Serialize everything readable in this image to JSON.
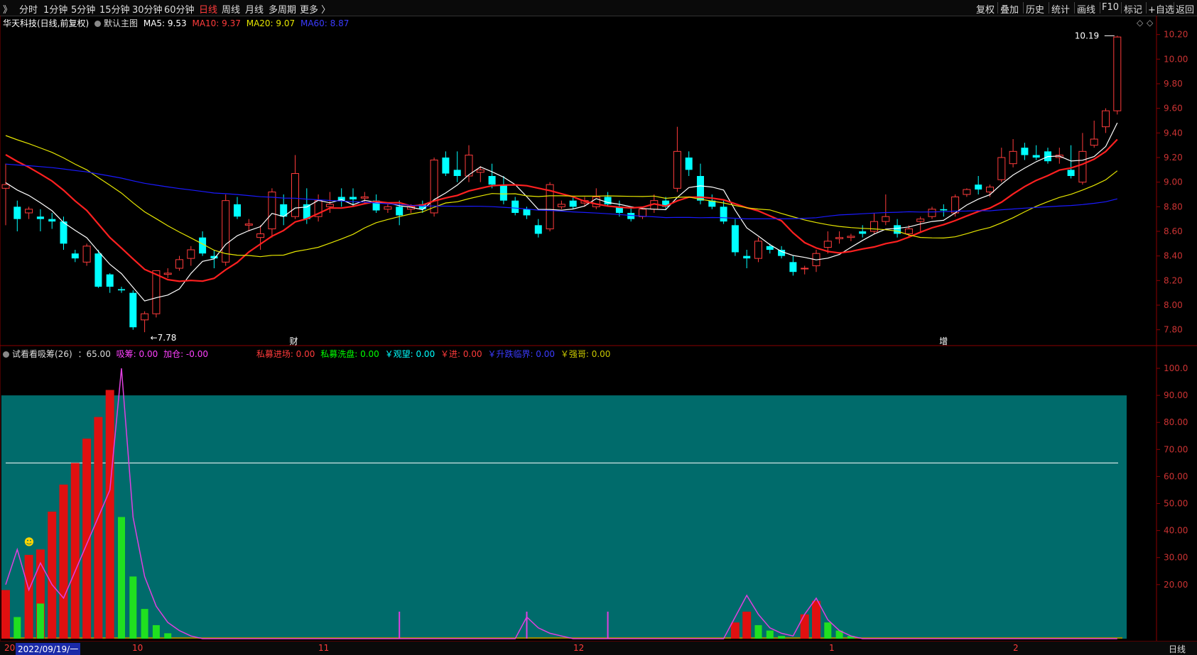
{
  "toolbar": {
    "back": "》",
    "periods": [
      "分时",
      "1分钟",
      "5分钟",
      "15分钟",
      "30分钟",
      "60分钟",
      "日线",
      "周线",
      "月线",
      "多周期",
      "更多 〉"
    ],
    "active_period": "日线",
    "right_items": [
      "复权",
      "叠加",
      "历史",
      "统计",
      "画线",
      "F10",
      "标记",
      "+自选",
      "返回"
    ]
  },
  "main_chart": {
    "title": "华天科技(日线,前复权)",
    "template": "默认主图",
    "ma5": "MA5: 9.53",
    "ma10": "MA10: 9.37",
    "ma20": "MA20: 9.07",
    "ma60": "MA60: 8.87",
    "high_label": "10.19",
    "low_label": "7.78",
    "event_cai": "财",
    "event_zeng": "增",
    "diamond": "◇",
    "y_ticks": [
      "10.20",
      "10.00",
      "9.80",
      "9.60",
      "9.40",
      "9.20",
      "9.00",
      "8.80",
      "8.60",
      "8.40",
      "8.20",
      "8.00",
      "7.80"
    ],
    "colors": {
      "up": "#ff3b3b",
      "down": "#00ffff",
      "ma5": "#ffffff",
      "ma10": "#ff2020",
      "ma20": "#e6e600",
      "ma60": "#1a1aff"
    }
  },
  "sub_chart": {
    "title": "试看看吸筹(26)",
    "value": "：65.00",
    "items": [
      {
        "label": "吸筹: 0.00",
        "color": "#ff40ff"
      },
      {
        "label": "加仓: -0.00",
        "color": "#ff40ff"
      },
      {
        "label": "私募进场: 0.00",
        "color": "#ff3b3b"
      },
      {
        "label": "私募洗盘: 0.00",
        "color": "#00ff00"
      },
      {
        "label": "￥观望: 0.00",
        "color": "#00ffff"
      },
      {
        "label": "￥进: 0.00",
        "color": "#ff3b3b"
      },
      {
        "label": "￥升跌临界: 0.00",
        "color": "#3b3bff"
      },
      {
        "label": "￥强哥: 0.00",
        "color": "#c8c800"
      }
    ],
    "y_ticks": [
      "100.0",
      "90.00",
      "80.00",
      "70.00",
      "60.00",
      "50.00",
      "40.00",
      "30.00",
      "20.00"
    ],
    "colors": {
      "band": "#006b6b",
      "line": "#ffffff",
      "red": "#e01010",
      "green": "#20e020",
      "magenta": "#e040e0",
      "base": "#9a8a00"
    }
  },
  "bottom": {
    "date": "2022/09/19/一",
    "start": "20",
    "months": [
      "10",
      "11",
      "12",
      "1",
      "2"
    ],
    "period": "日线"
  },
  "chart_data": [
    {
      "type": "candlestick",
      "title": "华天科技(日线,前复权)",
      "ylim": [
        7.7,
        10.25
      ],
      "high": 10.19,
      "low": 7.78,
      "candles": [
        [
          8.95,
          9.15,
          8.98,
          8.65
        ],
        [
          8.8,
          8.85,
          8.7,
          8.6
        ],
        [
          8.75,
          8.8,
          8.78,
          8.7
        ],
        [
          8.72,
          8.78,
          8.7,
          8.6
        ],
        [
          8.7,
          8.75,
          8.68,
          8.62
        ],
        [
          8.68,
          8.72,
          8.5,
          8.45
        ],
        [
          8.42,
          8.45,
          8.38,
          8.35
        ],
        [
          8.35,
          8.5,
          8.48,
          8.32
        ],
        [
          8.42,
          8.45,
          8.15,
          8.14
        ],
        [
          8.25,
          8.26,
          8.15,
          8.1
        ],
        [
          8.13,
          8.15,
          8.12,
          8.1
        ],
        [
          8.1,
          8.12,
          7.82,
          7.8
        ],
        [
          7.88,
          7.95,
          7.93,
          7.78
        ],
        [
          7.93,
          8.28,
          8.28,
          7.9
        ],
        [
          8.25,
          8.3,
          8.26,
          8.22
        ],
        [
          8.3,
          8.4,
          8.37,
          8.28
        ],
        [
          8.38,
          8.48,
          8.45,
          8.32
        ],
        [
          8.55,
          8.6,
          8.42,
          8.4
        ],
        [
          8.4,
          8.45,
          8.38,
          8.3
        ],
        [
          8.35,
          8.9,
          8.85,
          8.32
        ],
        [
          8.82,
          8.88,
          8.72,
          8.7
        ],
        [
          8.65,
          8.7,
          8.66,
          8.6
        ],
        [
          8.55,
          8.65,
          8.58,
          8.45
        ],
        [
          8.62,
          8.95,
          8.92,
          8.55
        ],
        [
          8.82,
          8.9,
          8.72,
          8.65
        ],
        [
          8.72,
          9.22,
          9.07,
          8.7
        ],
        [
          8.82,
          8.95,
          8.7,
          8.66
        ],
        [
          8.72,
          8.9,
          8.85,
          8.68
        ],
        [
          8.8,
          8.92,
          8.82,
          8.75
        ],
        [
          8.88,
          8.95,
          8.85,
          8.8
        ],
        [
          8.88,
          8.95,
          8.86,
          8.8
        ],
        [
          8.87,
          8.92,
          8.88,
          8.82
        ],
        [
          8.85,
          8.9,
          8.77,
          8.75
        ],
        [
          8.78,
          8.82,
          8.8,
          8.75
        ],
        [
          8.8,
          8.85,
          8.73,
          8.65
        ],
        [
          8.78,
          8.82,
          8.8,
          8.75
        ],
        [
          8.82,
          8.85,
          8.78,
          8.75
        ],
        [
          8.75,
          9.2,
          9.18,
          8.72
        ],
        [
          9.2,
          9.25,
          9.07,
          9.05
        ],
        [
          9.1,
          9.25,
          9.05,
          9.0
        ],
        [
          9.05,
          9.3,
          9.22,
          9.0
        ],
        [
          9.08,
          9.13,
          9.1,
          9.0
        ],
        [
          9.05,
          9.15,
          8.98,
          8.95
        ],
        [
          8.98,
          9.05,
          8.85,
          8.82
        ],
        [
          8.85,
          8.88,
          8.75,
          8.73
        ],
        [
          8.78,
          8.8,
          8.73,
          8.7
        ],
        [
          8.65,
          8.7,
          8.58,
          8.55
        ],
        [
          8.62,
          9.0,
          8.98,
          8.6
        ],
        [
          8.8,
          8.85,
          8.82,
          8.78
        ],
        [
          8.85,
          8.88,
          8.8,
          8.78
        ],
        [
          8.83,
          8.88,
          8.85,
          8.8
        ],
        [
          8.8,
          8.95,
          8.88,
          8.78
        ],
        [
          8.88,
          8.92,
          8.82,
          8.8
        ],
        [
          8.8,
          8.85,
          8.75,
          8.72
        ],
        [
          8.75,
          8.8,
          8.7,
          8.68
        ],
        [
          8.72,
          8.8,
          8.78,
          8.7
        ],
        [
          8.78,
          8.9,
          8.85,
          8.75
        ],
        [
          8.85,
          8.88,
          8.8,
          8.78
        ],
        [
          8.95,
          9.45,
          9.25,
          8.92
        ],
        [
          9.2,
          9.25,
          9.1,
          9.05
        ],
        [
          9.05,
          9.15,
          8.85,
          8.82
        ],
        [
          8.85,
          8.9,
          8.8,
          8.78
        ],
        [
          8.8,
          8.85,
          8.68,
          8.66
        ],
        [
          8.65,
          8.7,
          8.43,
          8.4
        ],
        [
          8.4,
          8.45,
          8.38,
          8.3
        ],
        [
          8.38,
          8.55,
          8.52,
          8.35
        ],
        [
          8.48,
          8.5,
          8.45,
          8.42
        ],
        [
          8.45,
          8.48,
          8.4,
          8.38
        ],
        [
          8.35,
          8.4,
          8.27,
          8.24
        ],
        [
          8.3,
          8.32,
          8.3,
          8.25
        ],
        [
          8.32,
          8.45,
          8.42,
          8.27
        ],
        [
          8.47,
          8.6,
          8.52,
          8.42
        ],
        [
          8.54,
          8.6,
          8.55,
          8.5
        ],
        [
          8.55,
          8.58,
          8.56,
          8.52
        ],
        [
          8.6,
          8.65,
          8.58,
          8.55
        ],
        [
          8.6,
          8.75,
          8.68,
          8.58
        ],
        [
          8.68,
          8.9,
          8.72,
          8.65
        ],
        [
          8.65,
          8.7,
          8.58,
          8.55
        ],
        [
          8.58,
          8.65,
          8.62,
          8.55
        ],
        [
          8.68,
          8.72,
          8.7,
          8.6
        ],
        [
          8.72,
          8.8,
          8.78,
          8.7
        ],
        [
          8.78,
          8.82,
          8.77,
          8.72
        ],
        [
          8.75,
          8.9,
          8.88,
          8.72
        ],
        [
          8.9,
          8.95,
          8.94,
          8.88
        ],
        [
          8.98,
          9.05,
          8.94,
          8.9
        ],
        [
          8.92,
          8.98,
          8.96,
          8.88
        ],
        [
          9.02,
          9.28,
          9.2,
          9.0
        ],
        [
          9.15,
          9.35,
          9.25,
          9.12
        ],
        [
          9.28,
          9.32,
          9.22,
          9.18
        ],
        [
          9.22,
          9.3,
          9.2,
          9.18
        ],
        [
          9.25,
          9.28,
          9.17,
          9.15
        ],
        [
          9.2,
          9.28,
          9.22,
          9.15
        ],
        [
          9.1,
          9.3,
          9.05,
          9.03
        ],
        [
          9.0,
          9.4,
          9.25,
          8.98
        ],
        [
          9.3,
          9.5,
          9.35,
          9.28
        ],
        [
          9.45,
          9.6,
          9.58,
          9.4
        ],
        [
          9.58,
          10.19,
          10.18,
          9.55
        ]
      ]
    },
    {
      "type": "bar",
      "title": "试看看吸筹(26)",
      "ylim": [
        0,
        105
      ],
      "threshold": 65,
      "band": 90,
      "red": [
        18,
        0,
        31,
        33,
        47,
        57,
        65,
        74,
        82,
        92,
        0,
        0,
        0,
        0,
        0,
        0,
        0,
        0,
        0,
        0,
        0,
        0,
        0,
        0,
        0,
        0,
        0,
        0,
        0,
        0,
        0,
        0,
        0,
        0,
        0,
        0,
        0,
        0,
        0,
        0,
        0,
        0,
        0,
        0,
        0,
        0,
        0,
        0,
        0,
        0,
        0,
        0,
        0,
        0,
        0,
        0,
        0,
        0,
        0,
        0,
        0,
        0,
        0,
        6,
        10,
        0,
        0,
        0,
        0,
        9,
        14,
        0,
        0,
        0,
        0,
        0,
        0,
        0,
        0,
        0,
        0,
        0,
        0,
        0,
        0,
        0,
        0,
        0,
        0,
        0,
        0,
        0,
        0,
        0,
        0,
        0,
        0
      ],
      "green": [
        0,
        8,
        0,
        13,
        0,
        0,
        0,
        0,
        0,
        0,
        45,
        23,
        11,
        5,
        2,
        0,
        0,
        0,
        0,
        0,
        0,
        0,
        0,
        0,
        0,
        0,
        0,
        0,
        0,
        0,
        0,
        0,
        0,
        0,
        0,
        0,
        0,
        0,
        0,
        0,
        0,
        0,
        0,
        0,
        0,
        0,
        0,
        0,
        0,
        0,
        0,
        0,
        0,
        0,
        0,
        0,
        0,
        0,
        0,
        0,
        0,
        0,
        0,
        0,
        0,
        5,
        3,
        1,
        0,
        0,
        0,
        6,
        3,
        1,
        0,
        0,
        0,
        0,
        0,
        0,
        0,
        0,
        0,
        0,
        0,
        0,
        0,
        0,
        0,
        0,
        0,
        0,
        0,
        0,
        0,
        0,
        0
      ],
      "line": [
        20,
        33,
        18,
        28,
        20,
        15,
        25,
        35,
        45,
        55,
        100,
        45,
        23,
        12,
        6,
        3,
        1,
        0,
        0,
        0,
        0,
        0,
        0,
        0,
        0,
        0,
        0,
        0,
        0,
        0,
        0,
        0,
        0,
        0,
        0,
        0,
        0,
        0,
        0,
        0,
        0,
        0,
        0,
        0,
        0,
        8,
        4,
        2,
        1,
        0,
        0,
        0,
        0,
        0,
        0,
        0,
        0,
        0,
        0,
        0,
        0,
        0,
        0,
        8,
        16,
        9,
        4,
        2,
        1,
        9,
        15,
        7,
        3,
        1,
        0,
        0,
        0,
        0,
        0,
        0,
        0,
        0,
        0,
        0,
        0,
        0,
        0,
        0,
        0,
        0,
        0,
        0,
        0,
        0,
        0,
        0,
        0
      ],
      "spikes": [
        34,
        45,
        52
      ]
    }
  ]
}
